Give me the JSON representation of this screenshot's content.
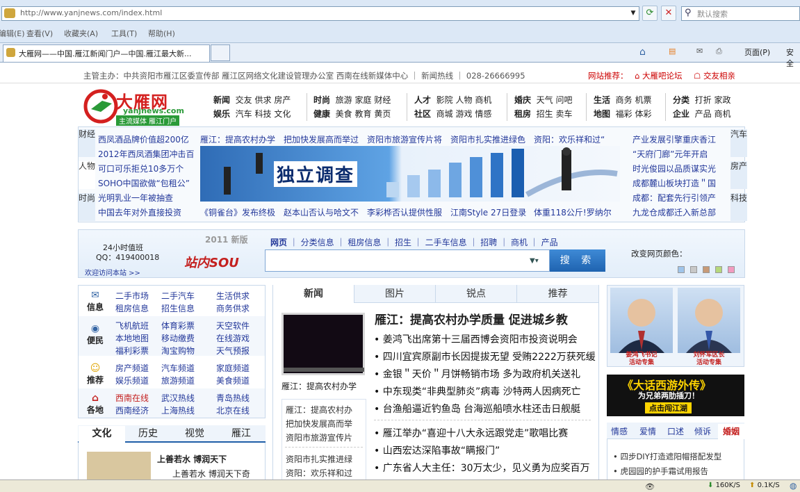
{
  "browser": {
    "url": "http://www.yanjnews.com/index.html",
    "search_placeholder": "默认搜索",
    "menu": [
      "编辑(E)",
      "查看(V)",
      "收藏夹(A)",
      "工具(T)",
      "帮助(H)"
    ],
    "tab_title": "大雁网——中国.雁江新闻门户—中国.雁江最大新...",
    "page_menu": "页面(P)",
    "safety_menu": "安全",
    "status_download": "160K/S",
    "status_upload": "0.1K/S"
  },
  "topbar": {
    "sponsor": "主管主办：中共资阳市雁江区委宣传部  雁江区网络文化建设管理办公室  西南在线新媒体中心 ｜ 新闻热线 ｜ 028-26666995",
    "recommend_label": "网站推荐：",
    "recommend_links": [
      "大雁吧论坛",
      "交友相亲"
    ]
  },
  "logo": {
    "name": "大雁网",
    "domain": "yanjnews.com",
    "slogan": "主流媒体  雁江门户"
  },
  "nav": [
    {
      "heads": [
        "新闻",
        "娱乐"
      ],
      "rows": [
        [
          "交友",
          "供求",
          "房产"
        ],
        [
          "汽车",
          "科技",
          "文化"
        ]
      ]
    },
    {
      "heads": [
        "时尚",
        "健康"
      ],
      "rows": [
        [
          "旅游",
          "家庭",
          "财经"
        ],
        [
          "美食",
          "教育",
          "黄页"
        ]
      ]
    },
    {
      "heads": [
        "人才",
        "社区"
      ],
      "rows": [
        [
          "影院",
          "人物",
          "商机"
        ],
        [
          "商城",
          "游戏",
          "情感"
        ]
      ]
    },
    {
      "heads": [
        "婚庆",
        "租房"
      ],
      "rows": [
        [
          "天气",
          "问吧"
        ],
        [
          "招生",
          "卖车"
        ]
      ]
    },
    {
      "heads": [
        "生活",
        "地图"
      ],
      "rows": [
        [
          "商务",
          "机票"
        ],
        [
          "福彩",
          "体彩"
        ]
      ]
    },
    {
      "heads": [
        "分类",
        "企业"
      ],
      "rows": [
        [
          "打折",
          "家政"
        ],
        [
          "产品",
          "商机"
        ]
      ]
    }
  ],
  "mid": {
    "left_tabs": [
      "财经",
      "人物",
      "时尚"
    ],
    "right_tabs": [
      "汽车",
      "房产",
      "科技"
    ],
    "left_links": [
      "西凤酒品牌价值超200亿",
      "2012年西凤酒集团冲击百",
      "可口可乐拒兑10多万个",
      "SOHO中国欲做“包租公”",
      "光明乳业一年被抽查",
      "中国去年对外直接投资"
    ],
    "top_links": [
      "雁江：提高农村办学",
      "把加快发展高而举过",
      "资阳市旅游宣传片将",
      "资阳市扎实推进绿色",
      "资阳：欢乐祥和过“"
    ],
    "banner_text": "独立调查",
    "bottom_links": [
      "《铜雀台》发布终极",
      "赵本山否认与哈文不",
      "李彩桦否认提供性服",
      "江南Style 27日登录",
      "体重118公斤!罗纳尔"
    ],
    "right_links": [
      "产业发展引擎重庆香江",
      "“天府门廊”元年开启",
      "时光俊园以品质谋实光",
      "成都麓山板块打造＂国",
      "成都：配套先行引领产",
      "九龙仓成都迁入新总部"
    ]
  },
  "search": {
    "hotline": "24小时值班",
    "qq": "QQ：419400018",
    "welcome": "欢迎访问本站 >>",
    "edition": "2011 新版",
    "brand": "站内SOU",
    "cats": [
      "网页",
      "分类信息",
      "租房信息",
      "招生",
      "二手车信息",
      "招聘",
      "商机",
      "产品"
    ],
    "button": "搜 索",
    "color_label": "改变网页颜色：",
    "swatches": [
      "#9fc4ea",
      "#c8c8c8",
      "#c79a78",
      "#b6d87c",
      "#f29bc0"
    ]
  },
  "left": {
    "groups": [
      {
        "icon": "mail-icon",
        "label": "信息",
        "rows": [
          [
            "二手市场",
            "二手汽车",
            "生活供求"
          ],
          [
            "租房信息",
            "招生信息",
            "商务供求"
          ]
        ]
      },
      {
        "icon": "gamepad-icon",
        "label": "便民",
        "rows": [
          [
            "飞机航班",
            "体育彩票",
            "天空软件"
          ],
          [
            "本地地图",
            "移动缴费",
            "在线游戏"
          ],
          [
            "福利彩票",
            "淘宝购物",
            "天气预报"
          ]
        ]
      },
      {
        "icon": "smile-icon",
        "label": "推荐",
        "rows": [
          [
            "房产频道",
            "汽车频道",
            "家庭频道"
          ],
          [
            "娱乐频道",
            "旅游频道",
            "美食频道"
          ]
        ]
      },
      {
        "icon": "home-icon",
        "label": "各地",
        "rows": [
          [
            "西南在线",
            "武汉热线",
            "青岛热线"
          ],
          [
            "西南经济",
            "上海热线",
            "北京在线"
          ]
        ]
      }
    ],
    "tabs": [
      "文化",
      "历史",
      "视觉",
      "雁江"
    ],
    "feature_title": "上善若水  博润天下",
    "feature_sub": "上善若水  博润天下奇"
  },
  "center": {
    "tabs": [
      "新闻",
      "图片",
      "锐点",
      "推荐"
    ],
    "video_caption": "雁江：提高农村办学",
    "side_links": [
      "雁江：提高农村办",
      "把加快发展高而举",
      "资阳市旅游宣传片",
      "资阳市扎实推进绿",
      "资阳：欢乐祥和过"
    ],
    "headline": "雁江：提高农村办学质量  促进城乡教",
    "news": [
      "姜鸿飞出席第十三届西博会资阳市投资说明会",
      "四川宜宾原副市长因提拔无望  受贿2222万获死缓",
      "金银＂天价＂月饼畅销市场  多为政府机关送礼",
      "中东现类“非典型肺炎”病毒 沙特两人因病死亡",
      "台渔船逼近钓鱼岛 台海巡船喷水柱还击日舰艇"
    ],
    "news2": [
      "雁江举办“喜迎十八大永远跟党走”歌唱比赛",
      "山西宏达深陷事故“瞒报门”",
      "广东省人大主任：30万太少，见义勇为应奖百万"
    ]
  },
  "right": {
    "people": [
      {
        "caption": "姜鸿飞书记\n活动专集"
      },
      {
        "caption": "刘怀军区长\n活动专集"
      }
    ],
    "ad_title": "《大话西游外传》",
    "ad_sub": "为兄弟两肋插刀！",
    "ad_btn": "点击闯江湖",
    "tabs": [
      "情感",
      "爱情",
      "口述",
      "倾诉",
      "婚姻"
    ],
    "links": [
      "四步DIY打造遮阳帽搭配发型",
      "虎园园的护手霜试用报告"
    ]
  }
}
